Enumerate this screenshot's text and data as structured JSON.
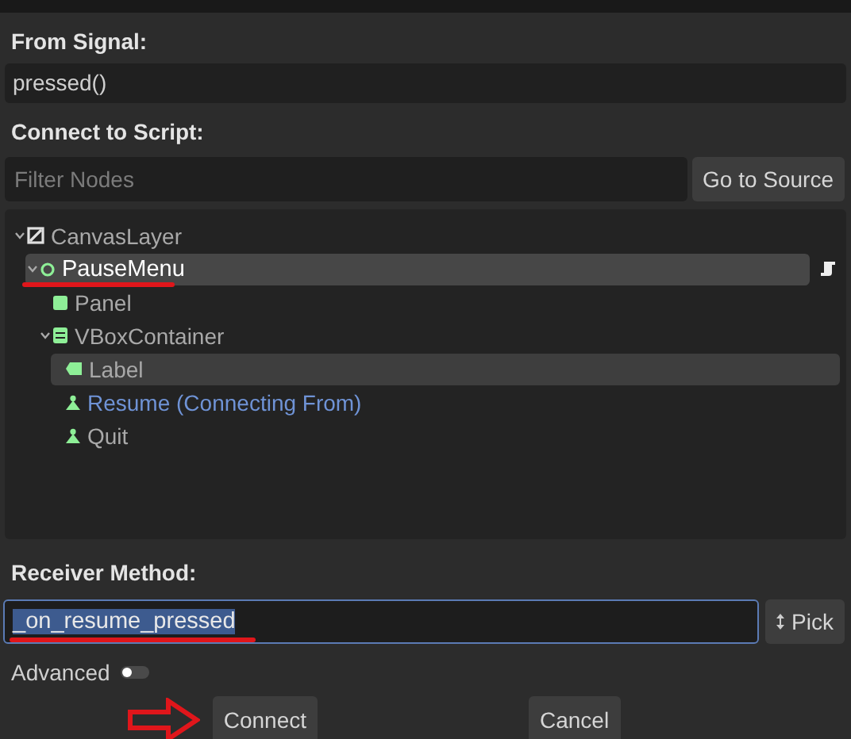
{
  "from_signal": {
    "label": "From Signal:",
    "value": "pressed()"
  },
  "connect_to_script": {
    "label": "Connect to Script:",
    "filter": {
      "placeholder": "Filter Nodes"
    },
    "go_button": "Go to Source"
  },
  "tree": [
    {
      "name": "CanvasLayer",
      "kind": "canvas",
      "expanded": true,
      "selected": false,
      "hovered": false,
      "highlighted": false,
      "underlined": false,
      "has_script": false,
      "children": [
        {
          "name": "PauseMenu",
          "kind": "control",
          "expanded": true,
          "selected": true,
          "hovered": false,
          "highlighted": false,
          "underlined": true,
          "has_script": true,
          "children": [
            {
              "name": "Panel",
              "kind": "panel",
              "selected": false,
              "hovered": false,
              "highlighted": false,
              "underlined": false,
              "has_script": false
            },
            {
              "name": "VBoxContainer",
              "kind": "vbox",
              "expanded": true,
              "selected": false,
              "hovered": false,
              "highlighted": false,
              "underlined": false,
              "has_script": false,
              "children": [
                {
                  "name": "Label",
                  "kind": "label",
                  "selected": false,
                  "hovered": true,
                  "highlighted": false,
                  "underlined": false,
                  "has_script": false
                },
                {
                  "name": "Resume (Connecting From)",
                  "kind": "button",
                  "selected": false,
                  "hovered": false,
                  "highlighted": true,
                  "underlined": false,
                  "has_script": false
                },
                {
                  "name": "Quit",
                  "kind": "button",
                  "selected": false,
                  "hovered": false,
                  "highlighted": false,
                  "underlined": false,
                  "has_script": false
                }
              ]
            }
          ]
        }
      ]
    }
  ],
  "receiver_method": {
    "label": "Receiver Method:",
    "value": "_on_resume_pressed",
    "text_selected": true,
    "underlined": true,
    "pick_button": "Pick"
  },
  "advanced": {
    "label": "Advanced",
    "on": false
  },
  "buttons": [
    {
      "label": "Connect",
      "arrow": true
    },
    {
      "label": "Cancel",
      "arrow": false
    }
  ]
}
